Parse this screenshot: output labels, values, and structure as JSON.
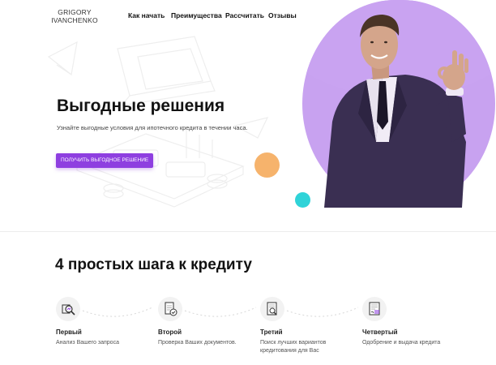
{
  "logo": {
    "line1": "GRIGORY",
    "line2": "IVANCHENKO"
  },
  "nav": {
    "items": [
      {
        "label": "Как начать"
      },
      {
        "label": "Преимущества"
      },
      {
        "label": "Рассчитать"
      },
      {
        "label": "Отзывы"
      }
    ]
  },
  "hero": {
    "title": "Выгодные решения",
    "subtitle": "Узнайте выгодные условия для ипотечного кредита в течении часа.",
    "cta_label": "ПОЛУЧИТЬ ВЫГОДНОЕ РЕШЕНИЕ"
  },
  "steps": {
    "title": "4 простых шага к кредиту",
    "items": [
      {
        "title": "Первый",
        "desc": "Анализ Вашего запроса",
        "icon": "search-chart-icon"
      },
      {
        "title": "Второй",
        "desc": "Проверка Ваших документов.",
        "icon": "document-check-icon"
      },
      {
        "title": "Третий",
        "desc": "Поиск лучших вариантов кредитования для Вас",
        "icon": "document-search-icon"
      },
      {
        "title": "Четвертый",
        "desc": "Одобрение и выдача кредита",
        "icon": "approval-document-icon"
      }
    ]
  },
  "colors": {
    "accent": "#8e3fe0",
    "circle": "#c8a2f0",
    "orange": "#f6b36c",
    "teal": "#2fd3d8"
  }
}
